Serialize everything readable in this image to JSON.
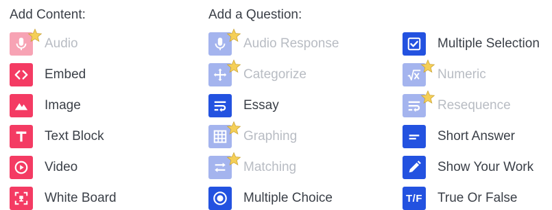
{
  "add_content": {
    "heading": "Add Content:",
    "items": [
      {
        "label": "Audio",
        "icon": "microphone-icon",
        "enabled": false,
        "premium": true
      },
      {
        "label": "Embed",
        "icon": "code-icon",
        "enabled": true,
        "premium": false
      },
      {
        "label": "Image",
        "icon": "mountain-image-icon",
        "enabled": true,
        "premium": false
      },
      {
        "label": "Text Block",
        "icon": "text-t-icon",
        "enabled": true,
        "premium": false
      },
      {
        "label": "Video",
        "icon": "play-circle-icon",
        "enabled": true,
        "premium": false
      },
      {
        "label": "White Board",
        "icon": "whiteboard-icon",
        "enabled": true,
        "premium": false
      }
    ]
  },
  "add_question": {
    "heading": "Add a Question:",
    "column1": [
      {
        "label": "Audio Response",
        "icon": "microphone-icon",
        "enabled": false,
        "premium": true
      },
      {
        "label": "Categorize",
        "icon": "categorize-icon",
        "enabled": false,
        "premium": true
      },
      {
        "label": "Essay",
        "icon": "text-wrap-icon",
        "enabled": true,
        "premium": false
      },
      {
        "label": "Graphing",
        "icon": "grid-icon",
        "enabled": false,
        "premium": true
      },
      {
        "label": "Matching",
        "icon": "swap-arrows-icon",
        "enabled": false,
        "premium": true
      },
      {
        "label": "Multiple Choice",
        "icon": "radio-icon",
        "enabled": true,
        "premium": false
      }
    ],
    "column2": [
      {
        "label": "Multiple Selection",
        "icon": "checkbox-icon",
        "enabled": true,
        "premium": false
      },
      {
        "label": "Numeric",
        "icon": "square-root-icon",
        "enabled": false,
        "premium": true
      },
      {
        "label": "Resequence",
        "icon": "text-wrap-icon",
        "enabled": false,
        "premium": true
      },
      {
        "label": "Short Answer",
        "icon": "short-answer-icon",
        "enabled": true,
        "premium": false
      },
      {
        "label": "Show Your Work",
        "icon": "pencil-icon",
        "enabled": true,
        "premium": false
      },
      {
        "label": "True Or False",
        "icon": "true-false-icon",
        "icon_text": "T/F",
        "enabled": true,
        "premium": false
      }
    ]
  },
  "colors": {
    "content_active": "#f43b63",
    "content_disabled": "#f7a3b4",
    "question_active": "#2352e0",
    "question_disabled": "#a4b4ee",
    "star": "#f5cf57",
    "text": "#3a3f47",
    "text_disabled": "#b8bcc3"
  }
}
